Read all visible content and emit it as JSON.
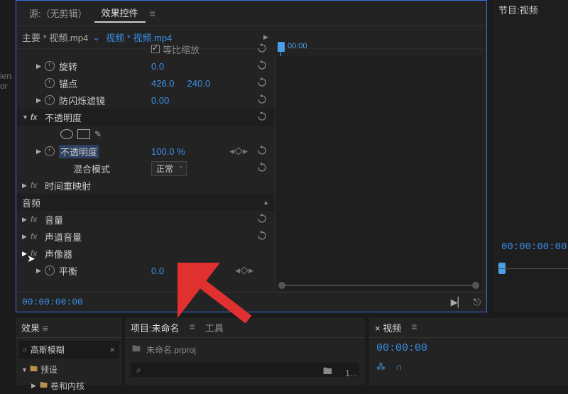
{
  "left_edge": "or",
  "effect_controls": {
    "tab_source": "源:（无剪辑）",
    "tab_effect": "效果控件",
    "clip_master": "主要 * 视频.mp4",
    "clip_instance": "视频 * 视频.mp4",
    "playhead_time": "00:00",
    "footer_time": "00:00:00:00",
    "uniform_scale": "等比缩放",
    "props": {
      "rotation": {
        "label": "旋转",
        "value": "0.0"
      },
      "anchor": {
        "label": "锚点",
        "x": "426.0",
        "y": "240.0"
      },
      "antiflicker": {
        "label": "防闪烁滤镜",
        "value": "0.00"
      },
      "opacity_section": "不透明度",
      "opacity": {
        "label": "不透明度",
        "value": "100.0 %"
      },
      "blend": {
        "label": "混合模式",
        "value": "正常"
      },
      "timeremap": "时间重映射",
      "audio_section": "音频",
      "volume": "音量",
      "channel_volume": "声道音量",
      "panner": "声像器",
      "balance": {
        "label": "平衡",
        "value": "0.0"
      }
    }
  },
  "program": {
    "title": "节目:视频",
    "timecode": "00:00:00:00"
  },
  "effects": {
    "title": "效果",
    "search": "高斯模糊",
    "presets": "预设",
    "lumetri": "卷和内核"
  },
  "project": {
    "tab_project": "项目:未命名",
    "tab_tools": "工具",
    "filename": "未命名.prproj",
    "item_count": "1..."
  },
  "sequence": {
    "tab": "× 视频",
    "timecode": "00:00:00"
  }
}
